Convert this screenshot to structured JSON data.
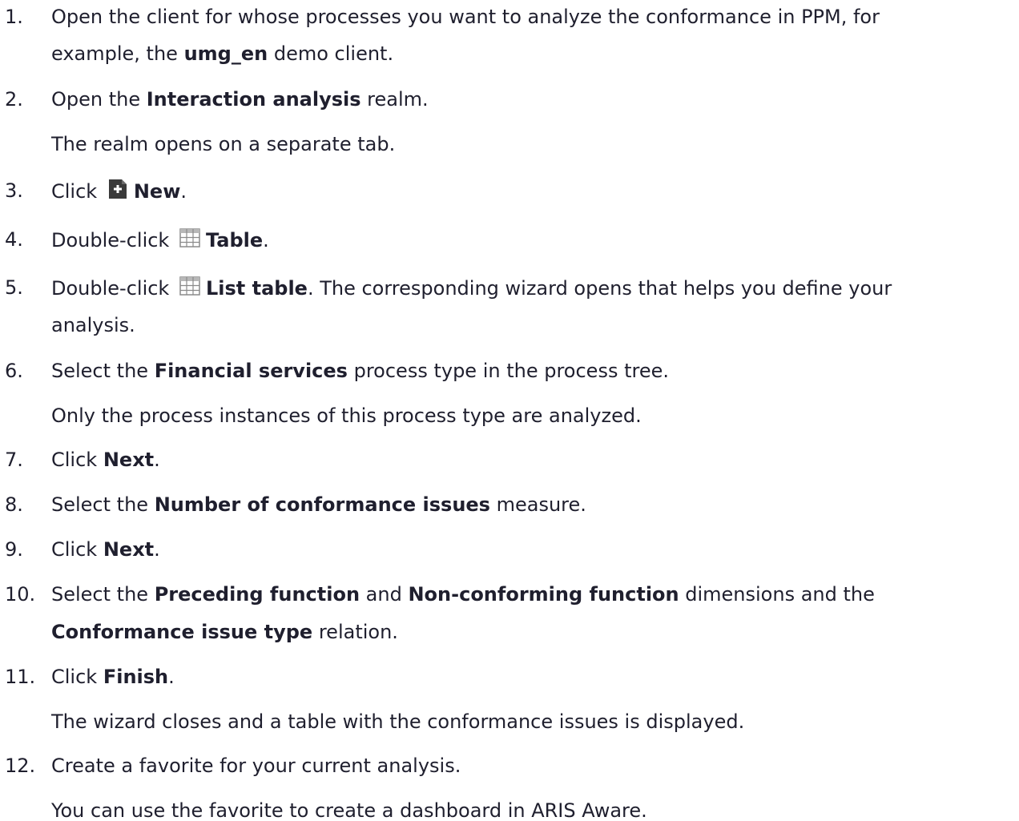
{
  "steps": [
    {
      "num": "1.",
      "line1_pre": "Open the client for whose processes you want to analyze the conformance in PPM, for",
      "line2_pre": "example, the ",
      "line2_bold": "umg_en",
      "line2_post": " demo client."
    },
    {
      "num": "2.",
      "pre": "Open the ",
      "bold": "Interaction analysis",
      "post": " realm.",
      "note": "The realm opens on a separate tab."
    },
    {
      "num": "3.",
      "pre": "Click ",
      "icon": "new-document-icon",
      "bold": "New",
      "post": "."
    },
    {
      "num": "4.",
      "pre": "Double-click ",
      "icon": "table-icon",
      "bold": "Table",
      "post": "."
    },
    {
      "num": "5.",
      "pre": "Double-click ",
      "icon": "table-icon",
      "bold": "List table",
      "post": ". The corresponding wizard opens that helps you define your",
      "line2": "analysis."
    },
    {
      "num": "6.",
      "pre": "Select the ",
      "bold": "Financial services",
      "post": " process type in the process tree.",
      "note": "Only the process instances of this process type are analyzed."
    },
    {
      "num": "7.",
      "pre": "Click ",
      "bold": "Next",
      "post": "."
    },
    {
      "num": "8.",
      "pre": "Select the ",
      "bold": "Number of conformance issues",
      "post": " measure."
    },
    {
      "num": "9.",
      "pre": "Click ",
      "bold": "Next",
      "post": "."
    },
    {
      "num": "10.",
      "pre": "Select the ",
      "bold": "Preceding function",
      "mid": " and ",
      "bold2": "Non-conforming function",
      "post": " dimensions and the",
      "line2_bold": "Conformance issue type",
      "line2_post": " relation."
    },
    {
      "num": "11.",
      "pre": "Click ",
      "bold": "Finish",
      "post": ".",
      "note": "The wizard closes and a table with the conformance issues is displayed."
    },
    {
      "num": "12.",
      "pre": "Create a favorite for your current analysis.",
      "note": "You can use the favorite to create a dashboard in ARIS Aware."
    }
  ],
  "colors": {
    "text": "#1f1f2e",
    "icon_dark": "#3a3a3a",
    "icon_grid": "#8a8a8a"
  }
}
